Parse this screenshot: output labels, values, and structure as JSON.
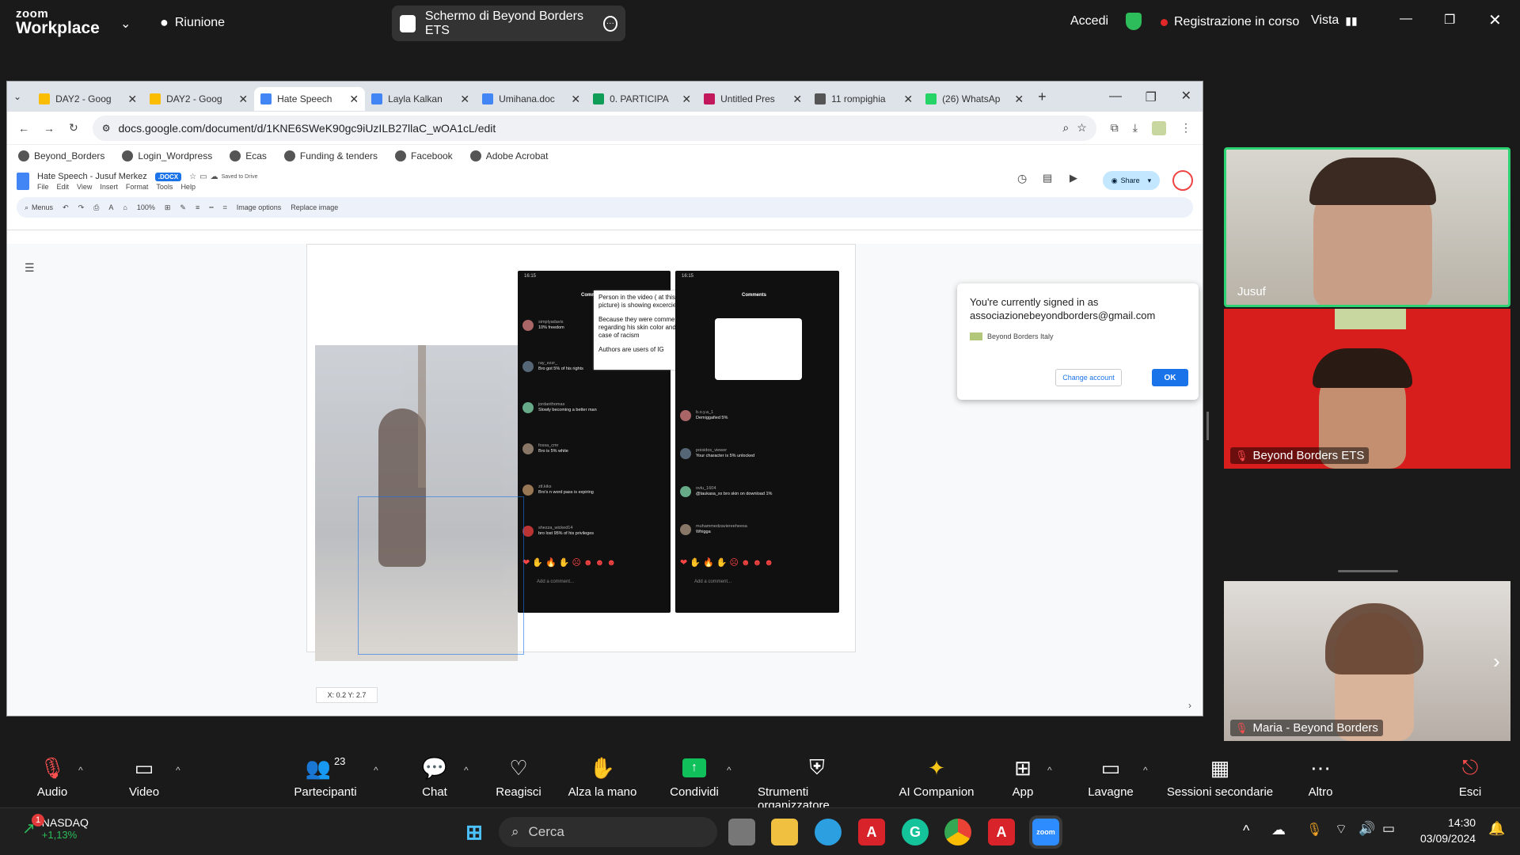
{
  "zoom": {
    "logo_line1": "zoom",
    "logo_line2": "Workplace",
    "meeting_label": "Riunione",
    "share_title": "Schermo di Beyond Borders ETS",
    "signin": "Accedi",
    "recording": "Registrazione in corso",
    "view": "Vista"
  },
  "chrome": {
    "tabs": [
      {
        "label": "DAY2 - Goog",
        "icon_color": "#fbbc04"
      },
      {
        "label": "DAY2 - Goog",
        "icon_color": "#fbbc04"
      },
      {
        "label": "Hate Speech",
        "icon_color": "#4285f4"
      },
      {
        "label": "Layla Kalkan",
        "icon_color": "#4285f4"
      },
      {
        "label": "Umihana.doc",
        "icon_color": "#4285f4"
      },
      {
        "label": "0. PARTICIPA",
        "icon_color": "#0f9d58"
      },
      {
        "label": "Untitled Pres",
        "icon_color": "#c2185b"
      },
      {
        "label": "11 rompighia",
        "icon_color": "#555555"
      },
      {
        "label": "(26) WhatsAp",
        "icon_color": "#25d366"
      }
    ],
    "url": "docs.google.com/document/d/1KNE6SWeK90gc9iUzILB27llaC_wOA1cL/edit",
    "bookmarks": [
      "Beyond_Borders",
      "Login_Wordpress",
      "Ecas",
      "Funding & tenders",
      "Facebook",
      "Adobe Acrobat"
    ]
  },
  "docs": {
    "title": "Hate Speech - Jusuf Merkez",
    "badge": ".DOCX",
    "saved": "Saved to Drive",
    "menu": [
      "File",
      "Edit",
      "View",
      "Insert",
      "Format",
      "Tools",
      "Help"
    ],
    "toolbar": {
      "menus": "Menus",
      "zoom": "100%",
      "image_options": "Image options",
      "replace_image": "Replace image"
    },
    "share_label": "Share",
    "coords": "X: 0.2   Y: 2.7"
  },
  "phone_overlay": {
    "time": "16:15",
    "header": "Comments",
    "annotation": [
      "Person in the video ( at this moment picture) is showing excercieses outdoors",
      "Because they were commenting regarding his skin color and clearly it is a case of racism",
      "Authors are users of IG"
    ],
    "comments_left": [
      {
        "user": "simplyadavis",
        "text": "10% freedom"
      },
      {
        "user": "ray_ezzr_",
        "text": "Bro got 5% of his rights"
      },
      {
        "user": "jordanthomas",
        "text": "Slowly becoming a better man"
      },
      {
        "user": "fossa_cmr",
        "text": "Bro is 5% white"
      },
      {
        "user": "ztl.kiks",
        "text": "Bro's n word pass is expiring"
      },
      {
        "user": "shezza_wicked14",
        "text": "bro lost 95% of his privileges"
      }
    ],
    "comments_right": [
      {
        "user": "b.o.y.a_1",
        "text": "Demiggafied 5%"
      },
      {
        "user": "poisidos_viewer",
        "text": "Your character is 5% unlocked"
      },
      {
        "user": "ovlu_1604",
        "text": "@taukasa_xx bro skin on download 1%"
      },
      {
        "user": "muhammedzaviereeheesa",
        "text": "Whigga"
      }
    ],
    "add_comment": "Add a comment..."
  },
  "popup": {
    "line1": "You're currently signed in as",
    "email": "associazionebeyondborders@gmail.com",
    "org": "Beyond Borders Italy",
    "change_account": "Change account",
    "ok": "OK"
  },
  "participants": [
    {
      "name": "Jusuf"
    },
    {
      "name": "Beyond Borders ETS"
    },
    {
      "name": "Maria - Beyond Borders"
    }
  ],
  "toolbar": {
    "audio": "Audio",
    "video": "Video",
    "participants": "Partecipanti",
    "participants_count": "23",
    "chat": "Chat",
    "reactions": "Reagisci",
    "raise_hand": "Alza la mano",
    "share": "Condividi",
    "host_tools": "Strumenti organizzatore",
    "ai": "AI Companion",
    "apps": "App",
    "whiteboards": "Lavagne",
    "breakout": "Sessioni secondarie",
    "more": "Altro",
    "leave": "Esci"
  },
  "taskbar": {
    "ticker_name": "NASDAQ",
    "ticker_value": "+1,13%",
    "notif": "1",
    "search": "Cerca",
    "time": "14:30",
    "date": "03/09/2024"
  }
}
